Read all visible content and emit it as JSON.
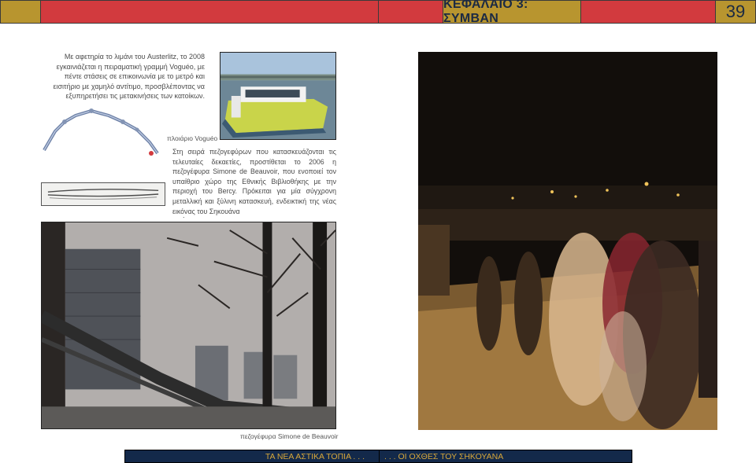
{
  "header": {
    "chapter_title": "ΚΕΦΑΛΑΙΟ 3: ΣΥΜΒΑΝ",
    "page_number": "39",
    "colors": {
      "gold": "#b8952f",
      "red": "#d23a3e",
      "navy": "#13294a"
    }
  },
  "body": {
    "intro_text": "Με αφετηρία το λιμάνι του Austerlitz, το 2008 εγκαινιάζεται η πειραματική γραμμή Voguéo, με πέντε στάσεις σε επικοινωνία με το μετρό και εισιτήριο με χαμηλό αντίτιμο, προσβλέποντας να εξυπηρετήσει τις μετακινήσεις των κατοίκων.",
    "boat_caption": "πλοιάριο Voguéo",
    "bridge_text": "Στη σειρά πεζογεφύρων που κατασκευάζονται τις τελευταίες δεκαετίες, προστίθεται το 2006 η πεζογέφυρα Simone de Beauvoir, που ενοποιεί τον υπαίθριο χώρο της Εθνικής Βιβλιοθήκης με την περιοχή του Bercy. Πρόκειται για μία σύγχρονη μεταλλική και ξύλινη κατασκευή, ενδεικτική της νέας εικόνας του Σηκουάνα",
    "bridge_text_end": ".",
    "bridge_caption": "πεζογέφυρα Simone de Beauvoir"
  },
  "footer": {
    "left_label": "ΤΑ ΝΕΑ ΑΣΤΙΚΑ ΤΟΠΙΑ . . .",
    "right_label": ". . . ΟΙ ΟΧΘΕΣ ΤΟΥ ΣΗΚΟΥΑΝΑ"
  }
}
